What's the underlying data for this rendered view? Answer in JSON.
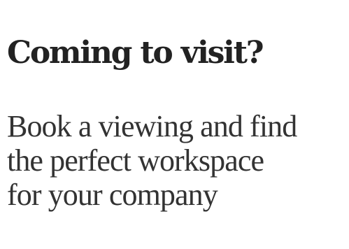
{
  "main": {
    "heading": "Coming to visit?",
    "description_lines": [
      "Book a viewing and find",
      "the perfect workspace",
      "for your company"
    ]
  },
  "colors": {
    "background": "#ffffff",
    "heading_text": "#222222",
    "body_text": "#333333"
  }
}
